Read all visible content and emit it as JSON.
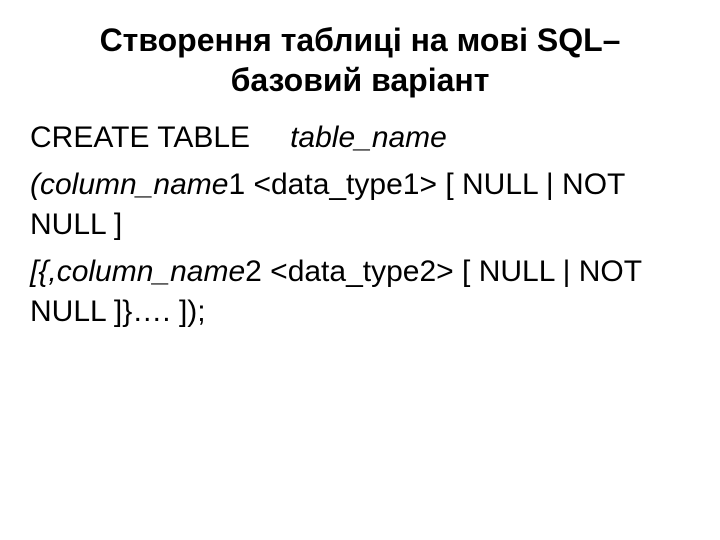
{
  "title": "Створення таблиці на мові SQL– базовий варіант",
  "line1": {
    "create": "CREATE TABLE",
    "tablename": "table_name"
  },
  "line2": {
    "open": "(column_name",
    "one": "1 ",
    "datatype": "<data_type1>",
    "tail": "  [ NULL | NOT NULL ]"
  },
  "line3": {
    "open": "[{,column_name",
    "two": "2 ",
    "datatype": "<data_type2>",
    "tail": " [ NULL | NOT NULL ]}…. ]);"
  }
}
